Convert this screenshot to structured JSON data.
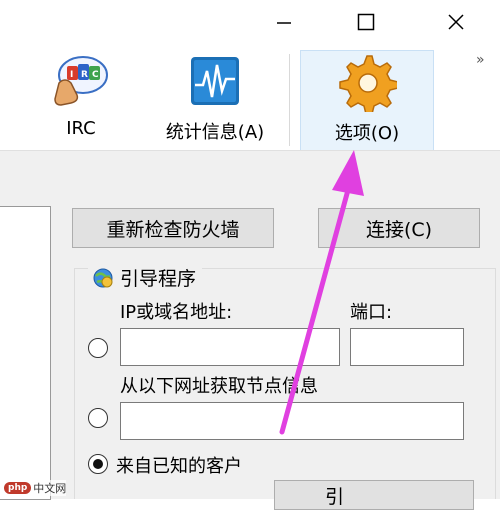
{
  "titlebar": {
    "minimize_icon": "minimize-icon",
    "maximize_icon": "maximize-icon",
    "close_icon": "close-icon"
  },
  "toolbar": {
    "items": [
      {
        "label": "IRC",
        "icon": "irc-icon"
      },
      {
        "label": "统计信息(A)",
        "icon": "statistics-icon"
      },
      {
        "label": "选项(O)",
        "icon": "gear-icon",
        "active": true
      }
    ],
    "overflow": "»"
  },
  "buttons": {
    "recheck_firewall": "重新检查防火墙",
    "connect": "连接(C)",
    "bottom_partial": "引"
  },
  "bootstrap": {
    "title": "引导程序",
    "ip_label": "IP或域名地址:",
    "port_label": "端口:",
    "ip_value": "",
    "port_value": "",
    "url_label": "从以下网址获取节点信息",
    "url_value": "",
    "known_clients_label": "来自已知的客户",
    "selected_option": "来自已知的客户"
  },
  "watermark": {
    "badge": "php",
    "site": "中文网"
  },
  "colors": {
    "arrow": "#e040e0",
    "active_tool_bg": "#e8f3fc",
    "panel_bg": "#f0f0f0"
  }
}
